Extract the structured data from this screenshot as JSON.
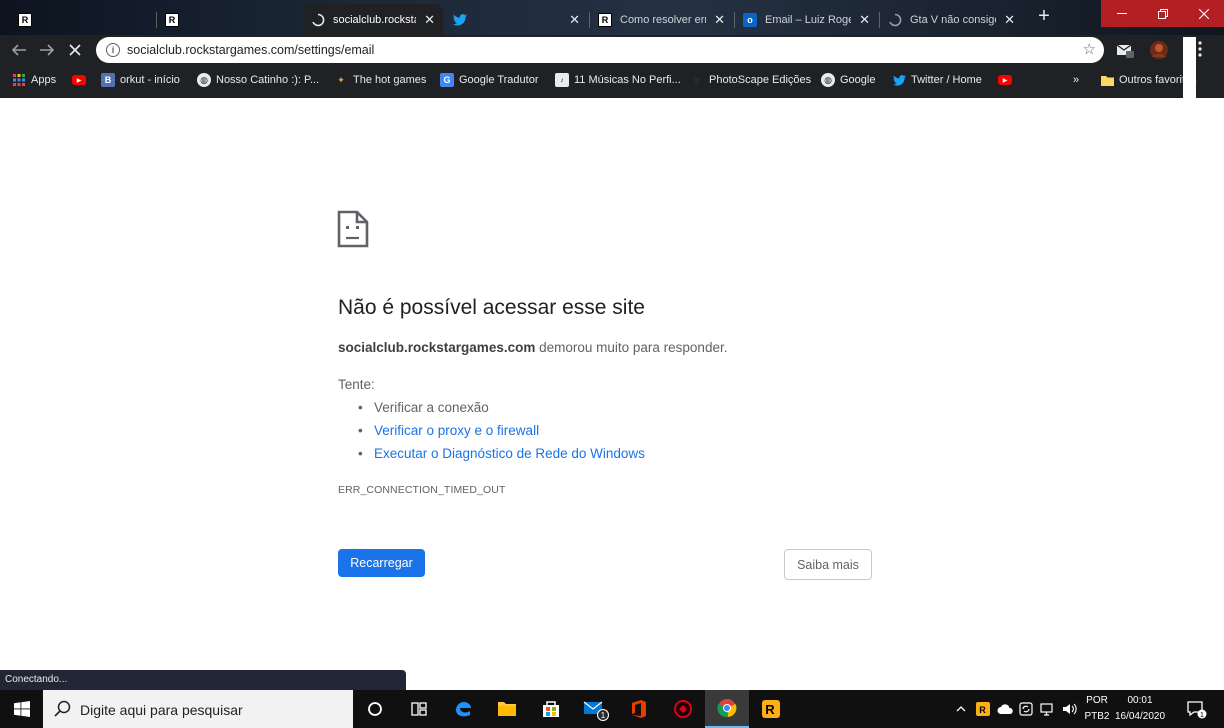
{
  "tabs": [
    {
      "title": "",
      "icon": "rockstar-icon",
      "active": false
    },
    {
      "title": "",
      "icon": "rockstar-icon",
      "active": false
    },
    {
      "title": "socialclub.rockstar",
      "icon": "loading-icon",
      "active": true
    },
    {
      "title": "",
      "icon": "twitter-icon",
      "active": false
    },
    {
      "title": "Como resolver err",
      "icon": "rockstar-icon",
      "active": false
    },
    {
      "title": "Email – Luiz Roge",
      "icon": "outlook-icon",
      "active": false
    },
    {
      "title": "Gta V não consigo",
      "icon": "loading-icon",
      "active": false
    }
  ],
  "omnibox": {
    "url": "socialclub.rockstargames.com/settings/email"
  },
  "bookmarks": {
    "apps": "Apps",
    "items": [
      {
        "label": "",
        "icon": "youtube-icon"
      },
      {
        "label": "orkut - início",
        "icon": "blogger-icon"
      },
      {
        "label": "Nosso Catinho :): P...",
        "icon": "globe-icon"
      },
      {
        "label": "The hot games",
        "icon": "game-icon"
      },
      {
        "label": "Google Tradutor",
        "icon": "translate-icon"
      },
      {
        "label": "11 Músicas No Perfi...",
        "icon": "music-icon"
      },
      {
        "label": "PhotoScape Edições",
        "icon": "heart-icon"
      },
      {
        "label": "Google",
        "icon": "globe-icon"
      },
      {
        "label": "Twitter / Home",
        "icon": "twitter-icon"
      },
      {
        "label": "",
        "icon": "youtube-icon"
      }
    ],
    "overflow": "»",
    "other": "Outros favoritos"
  },
  "error": {
    "title": "Não é possível acessar esse site",
    "host": "socialclub.rockstargames.com",
    "desc_suffix": " demorou muito para responder.",
    "try_label": "Tente:",
    "suggestions": [
      {
        "text": "Verificar a conexão",
        "link": false
      },
      {
        "text": "Verificar o proxy e o firewall",
        "link": true
      },
      {
        "text": "Executar o Diagnóstico de Rede do Windows",
        "link": true
      }
    ],
    "code": "ERR_CONNECTION_TIMED_OUT",
    "reload": "Recarregar",
    "details": "Saiba mais"
  },
  "status": "Conectando...",
  "taskbar": {
    "search_placeholder": "Digite aqui para pesquisar",
    "lang_line1": "POR",
    "lang_line2": "PTB2",
    "time": "00:01",
    "date": "16/04/2020",
    "mail_badge": "1",
    "notification_badge": "1"
  },
  "colors": {
    "accent_blue": "#1a73e8",
    "close_red": "#b41f24",
    "chrome_dark": "#1f2124"
  }
}
